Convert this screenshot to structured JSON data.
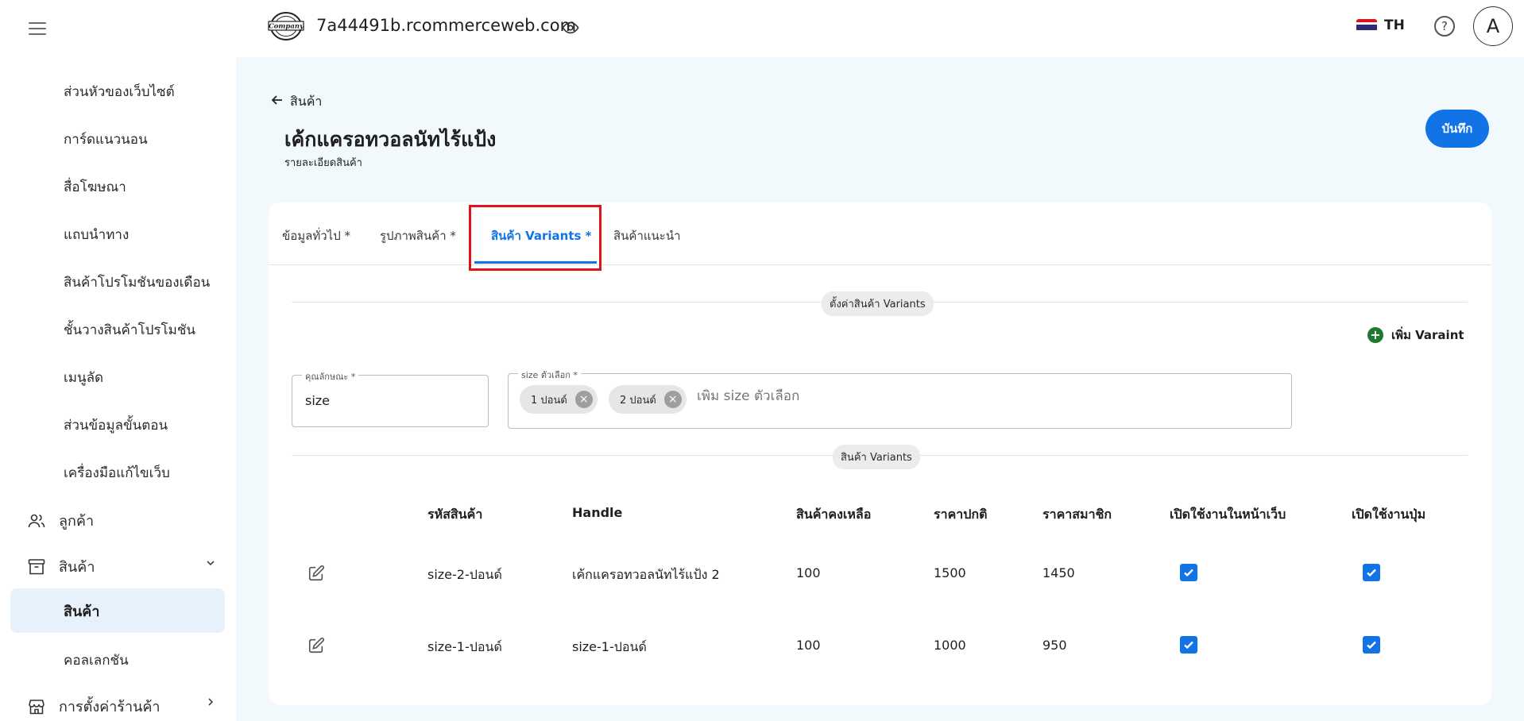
{
  "sidebar": {
    "items": [
      {
        "label": "ส่วนหัวของเว็บไซต์"
      },
      {
        "label": "การ์ดแนวนอน"
      },
      {
        "label": "สื่อโฆษณา"
      },
      {
        "label": "แถบนำทาง"
      },
      {
        "label": "สินค้าโปรโมชันของเดือน"
      },
      {
        "label": "ชั้นวางสินค้าโปรโมชัน"
      },
      {
        "label": "เมนูลัด"
      },
      {
        "label": "ส่วนข้อมูลขั้นตอน"
      },
      {
        "label": "เครื่องมือแก้ไขเว็บ"
      }
    ],
    "customers": {
      "label": "ลูกค้า",
      "icon": "users-icon"
    },
    "products": {
      "label": "สินค้า",
      "icon": "archive-box-icon"
    },
    "products_active": {
      "label": "สินค้า"
    },
    "collection": {
      "label": "คอลเลกชัน"
    },
    "store_settings": {
      "label": "การตั้งค่าร้านค้า",
      "icon": "store-icon"
    }
  },
  "topbar": {
    "site_title": "7a44491b.rcommerceweb.com",
    "logo_text": "Company",
    "lang": "TH",
    "avatar_letter": "A",
    "help_symbol": "?"
  },
  "page": {
    "back_label": "สินค้า",
    "title": "เค้กแครอทวอลนัทไร้แป้ง",
    "subtitle": "รายละเอียดสินค้า",
    "save_label": "บันทึก"
  },
  "tabs": [
    {
      "label": "ข้อมูลทั่วไป *"
    },
    {
      "label": "รูปภาพสินค้า *"
    },
    {
      "label": "สินค้า Variants *",
      "active": true
    },
    {
      "label": "สินค้าแนะนำ"
    }
  ],
  "variant_settings": {
    "section_label": "ตั้งค่าสินค้า Variants",
    "add_label": "เพิ่ม Varaint",
    "attribute_field": {
      "label": "คุณลักษณะ *",
      "value": "size"
    },
    "options_field": {
      "label": "size ตัวเลือก *",
      "chips": [
        "1 ปอนด์",
        "2 ปอนด์"
      ],
      "placeholder": "เพิ่ม size ตัวเลือก"
    }
  },
  "variants_table": {
    "section_label": "สินค้า Variants",
    "headers": [
      "รหัสสินค้า",
      "Handle",
      "สินค้าคงเหลือ",
      "ราคาปกติ",
      "ราคาสมาชิก",
      "เปิดใช้งานในหน้าเว็บ",
      "เปิดใช้งานปุ่ม"
    ],
    "rows": [
      {
        "sku": "size-2-ปอนด์",
        "handle": "เค้กแครอทวอลนัทไร้แป้ง 2",
        "stock": "100",
        "price": "1500",
        "member_price": "1450",
        "web_enabled": true,
        "button_enabled": true
      },
      {
        "sku": "size-1-ปอนด์",
        "handle": "size-1-ปอนด์",
        "stock": "100",
        "price": "1000",
        "member_price": "950",
        "web_enabled": true,
        "button_enabled": true
      }
    ]
  },
  "colors": {
    "accent": "#1273e6",
    "highlight": "#e0131a",
    "main_bg": "#f2f9fc",
    "add_green": "#1e7a2e"
  }
}
